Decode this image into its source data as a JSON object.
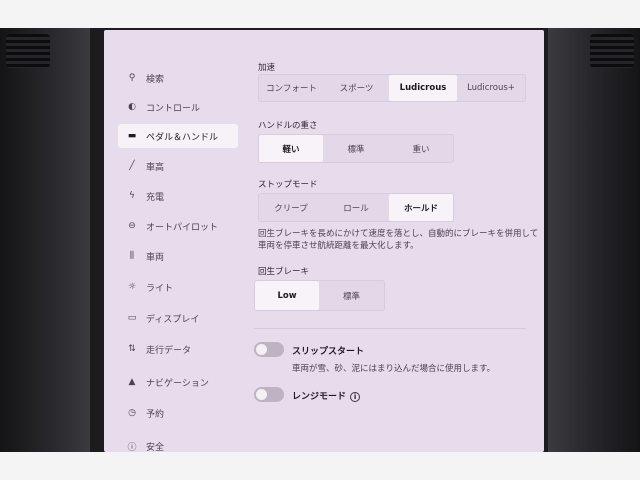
{
  "sidebar": {
    "items": [
      {
        "label": "検索",
        "icon": "search-icon",
        "glyph": "⚲"
      },
      {
        "label": "コントロール",
        "icon": "toggle-icon",
        "glyph": "◐"
      },
      {
        "label": "ペダル＆ハンドル",
        "icon": "car-icon",
        "glyph": "▬"
      },
      {
        "label": "車高",
        "icon": "wrench-icon",
        "glyph": "╱"
      },
      {
        "label": "充電",
        "icon": "bolt-icon",
        "glyph": "ϟ"
      },
      {
        "label": "オートパイロット",
        "icon": "steering-wheel-icon",
        "glyph": "⊖"
      },
      {
        "label": "車両",
        "icon": "sliders-icon",
        "glyph": "⫼"
      },
      {
        "label": "ライト",
        "icon": "sun-icon",
        "glyph": "☼"
      },
      {
        "label": "ディスプレイ",
        "icon": "display-icon",
        "glyph": "▭"
      },
      {
        "label": "走行データ",
        "icon": "trip-icon",
        "glyph": "⇅"
      },
      {
        "label": "ナビゲーション",
        "icon": "navigation-icon",
        "glyph": "▲"
      },
      {
        "label": "予約",
        "icon": "alarm-clock-icon",
        "glyph": "◷"
      },
      {
        "label": "安全",
        "icon": "safety-icon",
        "glyph": "ⓘ"
      }
    ]
  },
  "acceleration": {
    "label": "加速",
    "options": [
      "コンフォート",
      "スポーツ",
      "Ludicrous",
      "Ludicrous+"
    ],
    "selected": "Ludicrous"
  },
  "steering": {
    "label": "ハンドルの重さ",
    "options": [
      "軽い",
      "標準",
      "重い"
    ],
    "selected": "軽い"
  },
  "stop_mode": {
    "label": "ストップモード",
    "options": [
      "クリープ",
      "ロール",
      "ホールド"
    ],
    "selected": "ホールド",
    "description_line1": "回生ブレーキを長めにかけて速度を落とし、自動的にブレーキを併用して",
    "description_line2": "車両を停車させ航続距離を最大化します。"
  },
  "regen": {
    "label": "回生ブレーキ",
    "options": [
      "Low",
      "標準"
    ],
    "selected": "Low"
  },
  "slip_start": {
    "title": "スリップスタート",
    "subtitle": "車両が雪、砂、泥にはまり込んだ場合に使用します。",
    "enabled": false
  },
  "range_mode": {
    "title": "レンジモード",
    "info": "i",
    "enabled": false
  }
}
